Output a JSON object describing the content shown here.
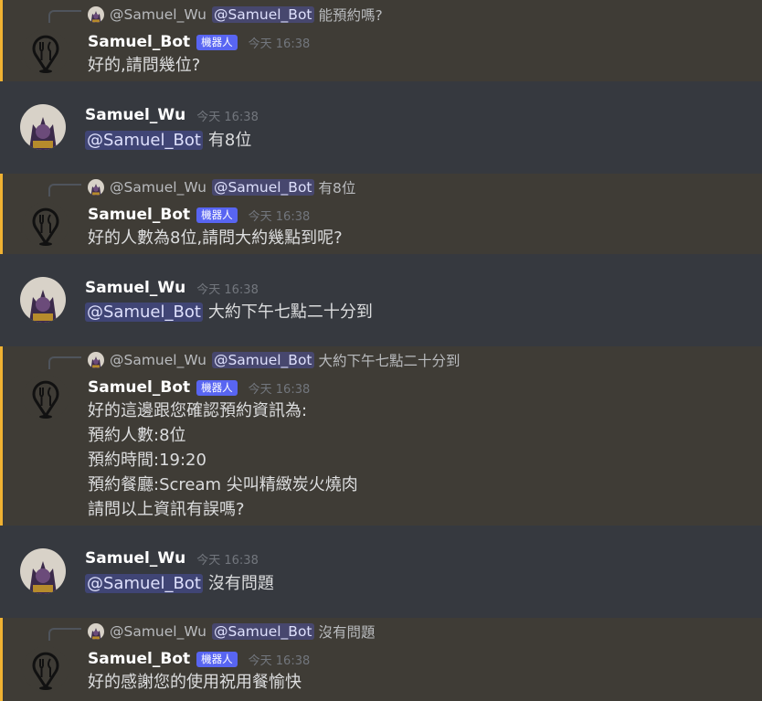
{
  "labels": {
    "bot_name": "Samuel_Bot",
    "bot_tag": "機器人",
    "user_name": "Samuel_Wu",
    "reply_user": "@Samuel_Wu",
    "mention_bot": "@Samuel_Bot",
    "timestamp": "今天 16:38"
  },
  "messages": [
    {
      "kind": "bot",
      "reply_text": "能預約嗎?",
      "lines": [
        "好的,請問幾位?"
      ]
    },
    {
      "kind": "user",
      "text": "有8位"
    },
    {
      "kind": "bot",
      "reply_text": "有8位",
      "lines": [
        "好的人數為8位,請問大約幾點到呢?"
      ]
    },
    {
      "kind": "user",
      "text": "大約下午七點二十分到"
    },
    {
      "kind": "bot",
      "reply_text": "大約下午七點二十分到",
      "lines": [
        "好的這邊跟您確認預約資訊為:",
        "預約人數:8位",
        "預約時間:19:20",
        "預約餐廳:Scream 尖叫精緻炭火燒肉",
        "請問以上資訊有誤嗎?"
      ]
    },
    {
      "kind": "user",
      "text": "沒有問題"
    },
    {
      "kind": "bot",
      "reply_text": "沒有問題",
      "lines": [
        "好的感謝您的使用祝用餐愉快"
      ]
    }
  ]
}
